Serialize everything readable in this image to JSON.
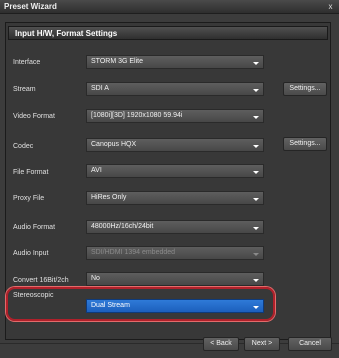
{
  "window": {
    "title": "Preset Wizard",
    "close_glyph": "x"
  },
  "section": {
    "title": "Input H/W, Format Settings"
  },
  "rows": [
    {
      "label": "Interface",
      "value": "STORM 3G Elite",
      "disabled": false,
      "selected": false
    },
    {
      "label": "Stream",
      "value": "SDI A",
      "disabled": false,
      "selected": false
    },
    {
      "label": "Video Format",
      "value": "[1080i][3D] 1920x1080 59.94i",
      "disabled": false,
      "selected": false
    },
    {
      "label": "Codec",
      "value": "Canopus HQX",
      "disabled": false,
      "selected": false
    },
    {
      "label": "File Format",
      "value": "AVI",
      "disabled": false,
      "selected": false
    },
    {
      "label": "Proxy File",
      "value": "HiRes Only",
      "disabled": false,
      "selected": false
    },
    {
      "label": "Audio Format",
      "value": "48000Hz/16ch/24bit",
      "disabled": false,
      "selected": false
    },
    {
      "label": "Audio Input",
      "value": "SDI/HDMI 1394 embedded",
      "disabled": true,
      "selected": false
    },
    {
      "label": "Convert 16Bit/2ch",
      "value": "No",
      "disabled": false,
      "selected": false
    },
    {
      "label": "Stereoscopic",
      "value": "Dual Stream",
      "disabled": false,
      "selected": true
    }
  ],
  "buttons": {
    "stream_settings": "Settings...",
    "codec_settings": "Settings...",
    "back": "< Back",
    "next": "Next >",
    "cancel": "Cancel"
  },
  "colors": {
    "highlight_ring": "#b0202a",
    "selected_combo": "#2f7ad8"
  }
}
